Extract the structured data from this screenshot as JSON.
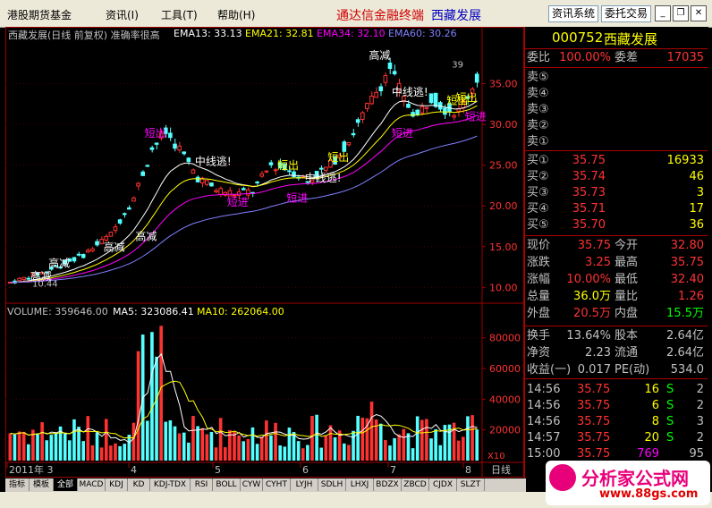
{
  "menubar": {
    "items": [
      "港股期货基金",
      "资讯(I)",
      "工具(T)",
      "帮助(H)"
    ],
    "title_app": "通达信金融终端",
    "title_stock": "西藏发展",
    "btn_info": "资讯系统",
    "btn_trade": "委托交易"
  },
  "chart": {
    "header": "西藏发展(日线 前复权) 准确率很高",
    "ema13": "EMA13: 33.13",
    "ema21": "EMA21: 32.81",
    "ema34": "EMA34: 32.10",
    "ema60": "EMA60: 30.26",
    "volume_header": "VOLUME: 359646.00",
    "ma5": "MA5: 323086.41",
    "ma10": "MA10: 262064.00",
    "price_ticks": [
      "35.00",
      "30.00",
      "25.00",
      "20.00",
      "15.00",
      "10.00"
    ],
    "volume_ticks": [
      "80000",
      "60000",
      "40000",
      "20000"
    ],
    "volume_unit": "X10",
    "date_labels": [
      "2011年 3",
      "4",
      "5",
      "6",
      "7",
      "8"
    ],
    "period": "日线",
    "low_label": "10.44",
    "signals": [
      "高减",
      "高减",
      "高减",
      "高减",
      "短出",
      "中线逃!",
      "短进",
      "短出",
      "中线逃!",
      "短进",
      "高减",
      "短进",
      "中线逃!",
      "短出",
      "短进",
      "短出",
      "短出"
    ],
    "top_label": "39",
    "colors": {
      "up": "#ff3232",
      "down": "#54ffff",
      "ema13": "#ffffff",
      "ema21": "#ffff00",
      "ema34": "#ff00ff",
      "ema60": "#8080ff"
    }
  },
  "quote": {
    "code": "000752",
    "name": "西藏发展",
    "wb_label": "委比",
    "wb": "100.00%",
    "wc_label": "委差",
    "wc": "17035",
    "sell": [
      {
        "label": "卖⑤"
      },
      {
        "label": "卖④"
      },
      {
        "label": "卖③"
      },
      {
        "label": "卖②"
      },
      {
        "label": "卖①"
      }
    ],
    "buy": [
      {
        "label": "买①",
        "price": "35.75",
        "vol": "16933"
      },
      {
        "label": "买②",
        "price": "35.74",
        "vol": "46"
      },
      {
        "label": "买③",
        "price": "35.73",
        "vol": "3"
      },
      {
        "label": "买④",
        "price": "35.71",
        "vol": "17"
      },
      {
        "label": "买⑤",
        "price": "35.70",
        "vol": "36"
      }
    ],
    "stats": [
      {
        "l1": "现价",
        "v1": "35.75",
        "l2": "今开",
        "v2": "32.80"
      },
      {
        "l1": "涨跌",
        "v1": "3.25",
        "l2": "最高",
        "v2": "35.75"
      },
      {
        "l1": "涨幅",
        "v1": "10.00%",
        "l2": "最低",
        "v2": "32.40"
      },
      {
        "l1": "总量",
        "v1": "36.0万",
        "l2": "量比",
        "v2": "1.26"
      },
      {
        "l1": "外盘",
        "v1": "20.5万",
        "l2": "内盘",
        "v2": "15.5万"
      }
    ],
    "stats2": [
      {
        "l1": "换手",
        "v1": "13.64%",
        "l2": "股本",
        "v2": "2.64亿"
      },
      {
        "l1": "净资",
        "v1": "2.23",
        "l2": "流通",
        "v2": "2.64亿"
      },
      {
        "l1": "收益(一)",
        "v1": "0.017",
        "l2": "PE(动)",
        "v2": "534.0"
      }
    ],
    "ticks": [
      {
        "t": "14:56",
        "p": "35.75",
        "v": "16",
        "f": "S",
        "n": "2"
      },
      {
        "t": "14:56",
        "p": "35.75",
        "v": "6",
        "f": "S",
        "n": "2"
      },
      {
        "t": "14:56",
        "p": "35.75",
        "v": "8",
        "f": "S",
        "n": "3"
      },
      {
        "t": "14:57",
        "p": "35.75",
        "v": "20",
        "f": "S",
        "n": "2"
      },
      {
        "t": "15:00",
        "p": "35.75",
        "v": "769",
        "f": "",
        "n": "95"
      }
    ]
  },
  "tabs": [
    "指标",
    "模板",
    "全部",
    "MACD",
    "KDJ",
    "KD",
    "KDJ-TDX",
    "RSI",
    "BOLL",
    "CYW",
    "CYHT",
    "LYJH",
    "SDLH",
    "LHXJ",
    "BDZX",
    "ZBCD",
    "CJDX",
    "SLZT"
  ],
  "watermark": {
    "text": "分析家公式网",
    "url": "www.88gs.com"
  }
}
